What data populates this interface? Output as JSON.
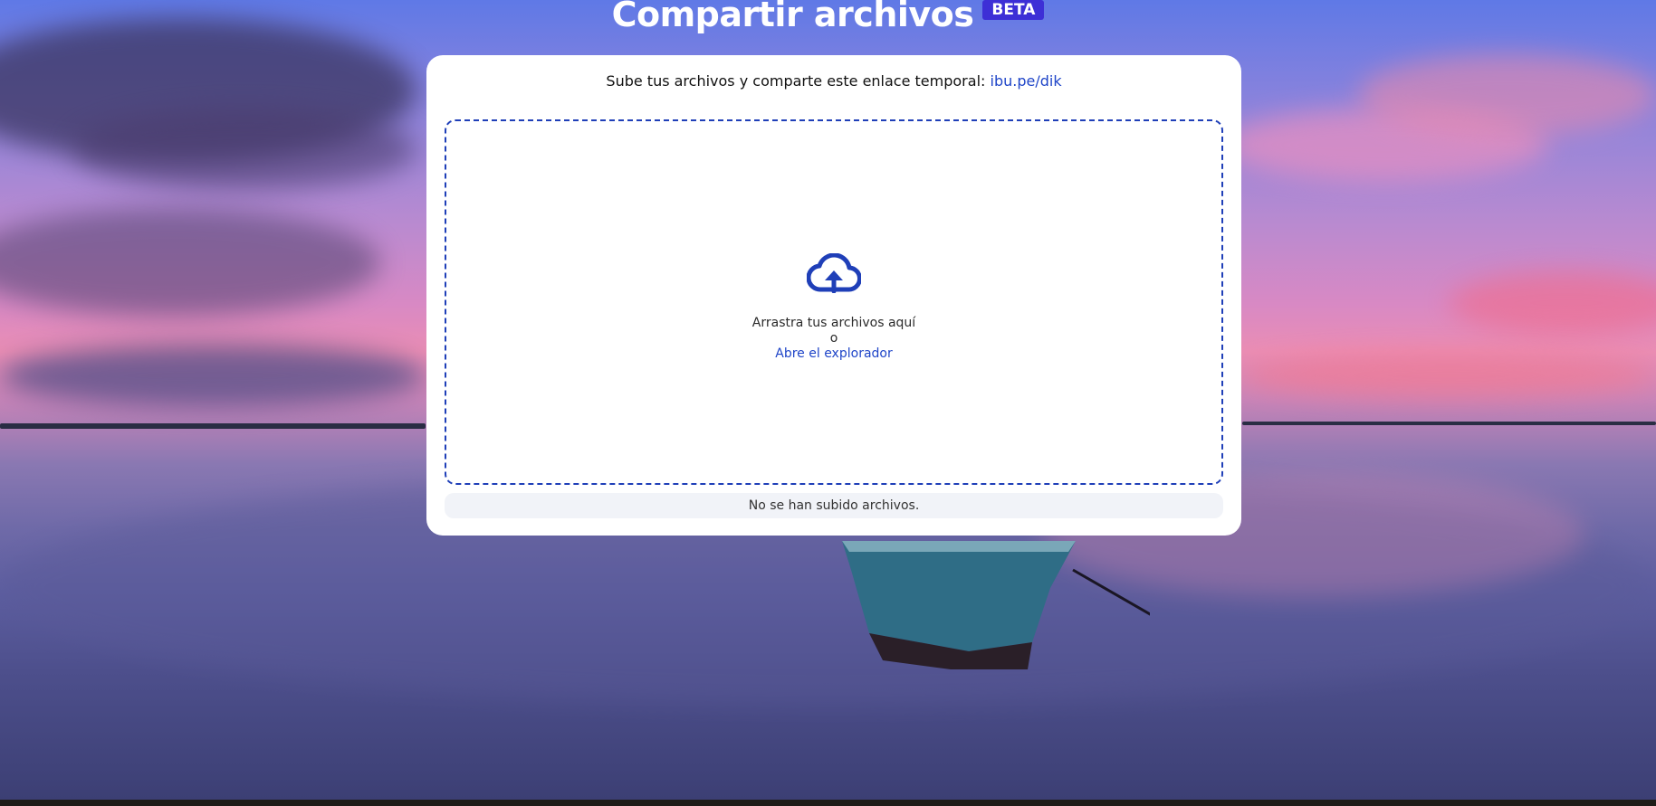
{
  "header": {
    "title": "Compartir archivos",
    "badge": "BETA"
  },
  "card": {
    "subtitle": "Sube tus archivos y comparte este enlace temporal:",
    "share_link": "ibu.pe/dik"
  },
  "dropzone": {
    "icon": "cloud-upload-icon",
    "drag_text": "Arrastra tus archivos aquí",
    "or_text": "o",
    "browse_label": "Abre el explorador"
  },
  "status": {
    "message": "No se han subido archivos."
  },
  "colors": {
    "accent": "#1f45c8",
    "badge": "#3d2fd6",
    "card": "#ffffff"
  }
}
